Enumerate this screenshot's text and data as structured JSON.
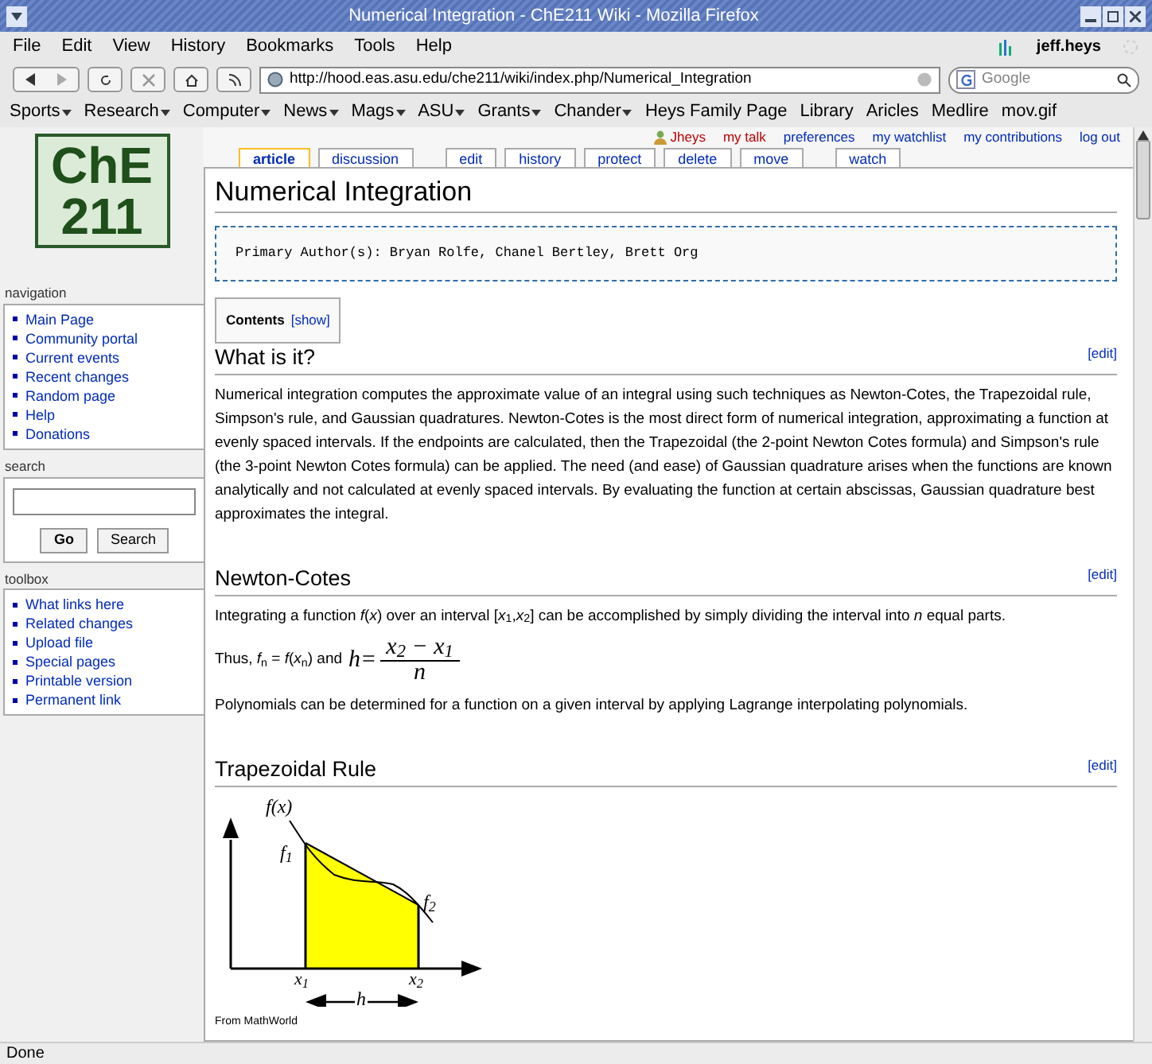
{
  "window": {
    "title": "Numerical Integration - ChE211 Wiki - Mozilla Firefox"
  },
  "menu_bar": [
    "File",
    "Edit",
    "View",
    "History",
    "Bookmarks",
    "Tools",
    "Help"
  ],
  "user_badge": "jeff.heys",
  "address_bar": {
    "url": "http://hood.eas.asu.edu/che211/wiki/index.php/Numerical_Integration"
  },
  "search_bar": {
    "placeholder": "Google"
  },
  "bookmarks": [
    {
      "label": "Sports",
      "dropdown": true
    },
    {
      "label": "Research",
      "dropdown": true
    },
    {
      "label": "Computer",
      "dropdown": true
    },
    {
      "label": "News",
      "dropdown": true
    },
    {
      "label": "Mags",
      "dropdown": true
    },
    {
      "label": "ASU",
      "dropdown": true
    },
    {
      "label": "Grants",
      "dropdown": true
    },
    {
      "label": "Chander",
      "dropdown": true
    },
    {
      "label": "Heys Family Page",
      "dropdown": false
    },
    {
      "label": "Library",
      "dropdown": false
    },
    {
      "label": "Aricles",
      "dropdown": false
    },
    {
      "label": "Medlire",
      "dropdown": false
    },
    {
      "label": "mov.gif",
      "dropdown": false
    }
  ],
  "personal_links": [
    {
      "label": "Jheys",
      "missing": true,
      "user": true
    },
    {
      "label": "my talk",
      "missing": true,
      "user": false
    },
    {
      "label": "preferences",
      "missing": false,
      "user": false
    },
    {
      "label": "my watchlist",
      "missing": false,
      "user": false
    },
    {
      "label": "my contributions",
      "missing": false,
      "user": false
    },
    {
      "label": "log out",
      "missing": false,
      "user": false
    }
  ],
  "tab_groups": [
    {
      "tabs": [
        {
          "label": "article",
          "selected": true
        },
        {
          "label": "discussion",
          "selected": false
        }
      ]
    },
    {
      "tabs": [
        {
          "label": "edit",
          "selected": false
        },
        {
          "label": "history",
          "selected": false
        },
        {
          "label": "protect",
          "selected": false
        },
        {
          "label": "delete",
          "selected": false
        },
        {
          "label": "move",
          "selected": false
        }
      ]
    },
    {
      "tabs": [
        {
          "label": "watch",
          "selected": false
        }
      ]
    }
  ],
  "logo": {
    "lines": [
      "ChE",
      "211"
    ]
  },
  "navigation": {
    "title": "navigation",
    "items": [
      "Main Page",
      "Community portal",
      "Current events",
      "Recent changes",
      "Random page",
      "Help",
      "Donations"
    ]
  },
  "search": {
    "title": "search",
    "buttons": [
      "Go",
      "Search"
    ]
  },
  "toolbox": {
    "title": "toolbox",
    "items": [
      "What links here",
      "Related changes",
      "Upload file",
      "Special pages",
      "Printable version",
      "Permanent link"
    ]
  },
  "article": {
    "title": "Numerical Integration",
    "author_box": "Primary Author(s): Bryan Rolfe, Chanel Bertley, Brett Org",
    "contents": {
      "label": "Contents",
      "toggle": "[show]"
    },
    "sections": [
      {
        "heading": "What is it?",
        "edit": "[edit]",
        "blocks": [
          {
            "kind": "paragraph",
            "text": "Numerical integration computes the approximate value of an integral using such techniques as Newton-Cotes, the Trapezoidal rule, Simpson's rule, and Gaussian quadratures. Newton-Cotes is the most direct form of numerical integration, approximating a function at evenly spaced intervals. If the endpoints are calculated, then the Trapezoidal (the 2-point Newton Cotes formula) and Simpson's rule (the 3-point Newton Cotes formula) can be applied. The need (and ease) of Gaussian quadrature arises when the functions are known analytically and not calculated at evenly spaced intervals. By evaluating the function at certain abscissas, Gaussian quadrature best approximates the integral."
          }
        ]
      },
      {
        "heading": "Newton-Cotes",
        "edit": "[edit]",
        "blocks": [
          {
            "kind": "paragraph",
            "text": "Integrating a function *f*(*x*) over an interval [*x*$_{1}$,*x*$_{2}$] can be accomplished by simply dividing the interval into *n* equal parts."
          },
          {
            "kind": "formula",
            "text": "Thus, *f*$_{n}$ = *f*(*x*$_{n}$) and",
            "lhs": "h=",
            "numerator": "x$_{2}$ − x$_{1}$",
            "denominator": "n"
          },
          {
            "kind": "paragraph",
            "text": "Polynomials can be determined for a function on a given interval by applying Lagrange interpolating polynomials."
          }
        ]
      },
      {
        "heading": "Trapezoidal Rule",
        "edit": "[edit]",
        "blocks": [
          {
            "kind": "figure",
            "labels": {
              "fx": "f(x)",
              "f1": "f$_{1}$",
              "f2": "f$_{2}$",
              "x1": "x$_{1}$",
              "x2": "x$_{2}$",
              "h": "h"
            },
            "caption": "From MathWorld"
          }
        ]
      }
    ]
  },
  "status_bar": "Done"
}
